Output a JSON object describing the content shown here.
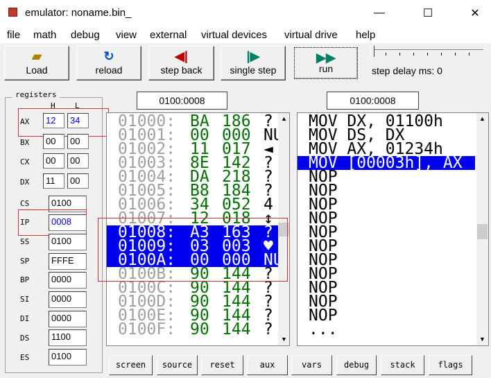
{
  "window": {
    "title": "emulator: noname.bin_",
    "minimize": "—",
    "maximize": "☐",
    "close": "✕"
  },
  "menu": [
    "file",
    "math",
    "debug",
    "view",
    "external",
    "virtual devices",
    "virtual drive",
    "help"
  ],
  "toolbar": {
    "load": "Load",
    "reload": "reload",
    "step_back": "step back",
    "single_step": "single step",
    "run": "run",
    "step_delay": "step delay ms: 0"
  },
  "registers": {
    "title": "registers",
    "h": "H",
    "l": "L",
    "AX": {
      "h": "12",
      "l": "34"
    },
    "BX": {
      "h": "00",
      "l": "00"
    },
    "CX": {
      "h": "00",
      "l": "00"
    },
    "DX": {
      "h": "11",
      "l": "00"
    },
    "CS": "0100",
    "IP": "0008",
    "SS": "0100",
    "SP": "FFFE",
    "BP": "0000",
    "SI": "0000",
    "DI": "0000",
    "DS": "1100",
    "ES": "0100"
  },
  "mem_address": "0100:0008",
  "dis_address": "0100:0008",
  "memory": [
    {
      "addr": "01000:",
      "hex": "BA",
      "dec": "186",
      "chr": "?"
    },
    {
      "addr": "01001:",
      "hex": "00",
      "dec": "000",
      "chr": "NU"
    },
    {
      "addr": "01002:",
      "hex": "11",
      "dec": "017",
      "chr": "◄"
    },
    {
      "addr": "01003:",
      "hex": "8E",
      "dec": "142",
      "chr": "?"
    },
    {
      "addr": "01004:",
      "hex": "DA",
      "dec": "218",
      "chr": "?"
    },
    {
      "addr": "01005:",
      "hex": "B8",
      "dec": "184",
      "chr": "?"
    },
    {
      "addr": "01006:",
      "hex": "34",
      "dec": "052",
      "chr": "4"
    },
    {
      "addr": "01007:",
      "hex": "12",
      "dec": "018",
      "chr": "↕"
    },
    {
      "addr": "01008:",
      "hex": "A3",
      "dec": "163",
      "chr": "?"
    },
    {
      "addr": "01009:",
      "hex": "03",
      "dec": "003",
      "chr": "♥"
    },
    {
      "addr": "0100A:",
      "hex": "00",
      "dec": "000",
      "chr": "NU"
    },
    {
      "addr": "0100B:",
      "hex": "90",
      "dec": "144",
      "chr": "?"
    },
    {
      "addr": "0100C:",
      "hex": "90",
      "dec": "144",
      "chr": "?"
    },
    {
      "addr": "0100D:",
      "hex": "90",
      "dec": "144",
      "chr": "?"
    },
    {
      "addr": "0100E:",
      "hex": "90",
      "dec": "144",
      "chr": "?"
    },
    {
      "addr": "0100F:",
      "hex": "90",
      "dec": "144",
      "chr": "?"
    }
  ],
  "disasm": [
    "MOV DX, 01100h",
    "MOV DS, DX",
    "MOV AX, 01234h",
    "MOV [00003h], AX",
    "NOP",
    "NOP",
    "NOP",
    "NOP",
    "NOP",
    "NOP",
    "NOP",
    "NOP",
    "NOP",
    "NOP",
    "NOP",
    "..."
  ],
  "bottom": [
    "screen",
    "source",
    "reset",
    "aux",
    "vars",
    "debug",
    "stack",
    "flags"
  ],
  "colors": {
    "selection": "#0000f0",
    "hex": "#007000",
    "addr": "#a0a0a0",
    "highlight": "#d03030"
  }
}
